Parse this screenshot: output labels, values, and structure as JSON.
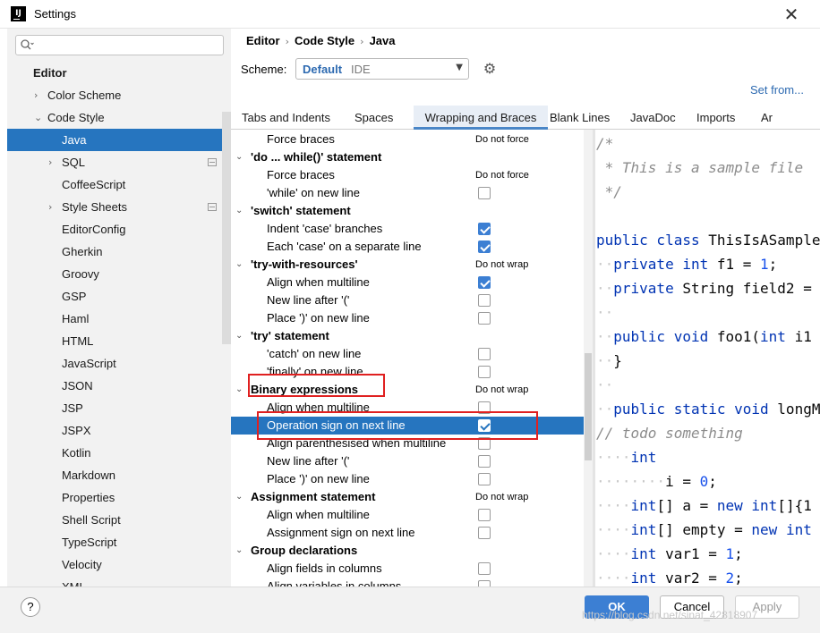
{
  "window": {
    "title": "Settings",
    "app_icon": "intellij-icon",
    "close_label": "✕"
  },
  "sidebar": {
    "search_placeholder": "",
    "items": [
      {
        "label": "Editor",
        "indent": 0,
        "bold": true
      },
      {
        "label": "Color Scheme",
        "indent": 1,
        "arrow": "›"
      },
      {
        "label": "Code Style",
        "indent": 1,
        "arrow": "⌄"
      },
      {
        "label": "Java",
        "indent": 2,
        "selected": true
      },
      {
        "label": "SQL",
        "indent": 2,
        "arrow": "›",
        "project": true
      },
      {
        "label": "CoffeeScript",
        "indent": 2
      },
      {
        "label": "Style Sheets",
        "indent": 2,
        "arrow": "›",
        "project": true
      },
      {
        "label": "EditorConfig",
        "indent": 2
      },
      {
        "label": "Gherkin",
        "indent": 2
      },
      {
        "label": "Groovy",
        "indent": 2
      },
      {
        "label": "GSP",
        "indent": 2
      },
      {
        "label": "Haml",
        "indent": 2
      },
      {
        "label": "HTML",
        "indent": 2
      },
      {
        "label": "JavaScript",
        "indent": 2
      },
      {
        "label": "JSON",
        "indent": 2
      },
      {
        "label": "JSP",
        "indent": 2
      },
      {
        "label": "JSPX",
        "indent": 2
      },
      {
        "label": "Kotlin",
        "indent": 2
      },
      {
        "label": "Markdown",
        "indent": 2
      },
      {
        "label": "Properties",
        "indent": 2
      },
      {
        "label": "Shell Script",
        "indent": 2
      },
      {
        "label": "TypeScript",
        "indent": 2
      },
      {
        "label": "Velocity",
        "indent": 2
      },
      {
        "label": "XML",
        "indent": 2
      }
    ]
  },
  "breadcrumb": [
    "Editor",
    "Code Style",
    "Java"
  ],
  "scheme": {
    "label": "Scheme:",
    "value": "Default",
    "sub": "IDE",
    "set_from": "Set from..."
  },
  "tabs": [
    {
      "label": "Tabs and Indents"
    },
    {
      "label": "Spaces"
    },
    {
      "label": "Wrapping and Braces",
      "active": true
    },
    {
      "label": "Blank Lines"
    },
    {
      "label": "JavaDoc"
    },
    {
      "label": "Imports"
    },
    {
      "label": "Ar"
    }
  ],
  "options": [
    {
      "label": "Force braces",
      "level": 1,
      "value": "Do not force"
    },
    {
      "label": "'do ... while()' statement",
      "level": 0
    },
    {
      "label": "Force braces",
      "level": 1,
      "value": "Do not force"
    },
    {
      "label": "'while' on new line",
      "level": 1,
      "checkbox": false
    },
    {
      "label": "'switch' statement",
      "level": 0
    },
    {
      "label": "Indent 'case' branches",
      "level": 1,
      "checkbox": true
    },
    {
      "label": "Each 'case' on a separate line",
      "level": 1,
      "checkbox": true
    },
    {
      "label": "'try-with-resources'",
      "level": 0,
      "value": "Do not wrap"
    },
    {
      "label": "Align when multiline",
      "level": 1,
      "checkbox": true
    },
    {
      "label": "New line after '('",
      "level": 1,
      "checkbox": false
    },
    {
      "label": "Place ')' on new line",
      "level": 1,
      "checkbox": false
    },
    {
      "label": "'try' statement",
      "level": 0
    },
    {
      "label": "'catch' on new line",
      "level": 1,
      "checkbox": false
    },
    {
      "label": "'finally' on new line",
      "level": 1,
      "checkbox": false
    },
    {
      "label": "Binary expressions",
      "level": 0,
      "value": "Do not wrap"
    },
    {
      "label": "Align when multiline",
      "level": 1,
      "checkbox": false
    },
    {
      "label": "Operation sign on next line",
      "level": 1,
      "checkbox": true,
      "selected": true
    },
    {
      "label": "Align parenthesised when multiline",
      "level": 1,
      "checkbox": false
    },
    {
      "label": "New line after '('",
      "level": 1,
      "checkbox": false
    },
    {
      "label": "Place ')' on new line",
      "level": 1,
      "checkbox": false
    },
    {
      "label": "Assignment statement",
      "level": 0,
      "value": "Do not wrap"
    },
    {
      "label": "Align when multiline",
      "level": 1,
      "checkbox": false
    },
    {
      "label": "Assignment sign on next line",
      "level": 1,
      "checkbox": false
    },
    {
      "label": "Group declarations",
      "level": 0
    },
    {
      "label": "Align fields in columns",
      "level": 1,
      "checkbox": false
    },
    {
      "label": "Align variables in columns",
      "level": 1,
      "checkbox": false
    }
  ],
  "preview": {
    "lines": [
      [
        [
          "cm",
          "/*"
        ]
      ],
      [
        [
          "cm",
          " * This is a sample file"
        ]
      ],
      [
        [
          "cm",
          " */"
        ]
      ],
      [],
      [
        [
          "kw",
          "public class "
        ],
        [
          "txt",
          "ThisIsASampleClass"
        ]
      ],
      [
        [
          "ws",
          "··"
        ],
        [
          "kw",
          "private int "
        ],
        [
          "txt",
          "f1 = "
        ],
        [
          "num",
          "1"
        ],
        [
          "txt",
          ";"
        ]
      ],
      [
        [
          "ws",
          "··"
        ],
        [
          "kw",
          "private "
        ],
        [
          "txt",
          "String field2 = "
        ]
      ],
      [
        [
          "ws",
          "··"
        ]
      ],
      [
        [
          "ws",
          "··"
        ],
        [
          "kw",
          "public void "
        ],
        [
          "txt",
          "foo1("
        ],
        [
          "kw",
          "int "
        ],
        [
          "txt",
          "i1"
        ]
      ],
      [
        [
          "ws",
          "··"
        ],
        [
          "txt",
          "}"
        ]
      ],
      [
        [
          "ws",
          "··"
        ]
      ],
      [
        [
          "ws",
          "··"
        ],
        [
          "kw",
          "public static void "
        ],
        [
          "txt",
          "longMethod"
        ]
      ],
      [
        [
          "cm",
          "// todo something"
        ]
      ],
      [
        [
          "ws",
          "····"
        ],
        [
          "kw",
          "int"
        ]
      ],
      [
        [
          "ws",
          "········"
        ],
        [
          "txt",
          "i = "
        ],
        [
          "num",
          "0"
        ],
        [
          "txt",
          ";"
        ]
      ],
      [
        [
          "ws",
          "····"
        ],
        [
          "kw",
          "int"
        ],
        [
          "txt",
          "[] a = "
        ],
        [
          "kw",
          "new int"
        ],
        [
          "txt",
          "[]{1"
        ]
      ],
      [
        [
          "ws",
          "····"
        ],
        [
          "kw",
          "int"
        ],
        [
          "txt",
          "[] empty = "
        ],
        [
          "kw",
          "new int"
        ]
      ],
      [
        [
          "ws",
          "····"
        ],
        [
          "kw",
          "int "
        ],
        [
          "txt",
          "var1 = "
        ],
        [
          "num",
          "1"
        ],
        [
          "txt",
          ";"
        ]
      ],
      [
        [
          "ws",
          "····"
        ],
        [
          "kw",
          "int "
        ],
        [
          "txt",
          "var2 = "
        ],
        [
          "num",
          "2"
        ],
        [
          "txt",
          ";"
        ]
      ]
    ]
  },
  "footer": {
    "help": "?",
    "ok": "OK",
    "cancel": "Cancel",
    "apply": "Apply",
    "watermark": "https://blog.csdn.net/sinat_42818907"
  }
}
